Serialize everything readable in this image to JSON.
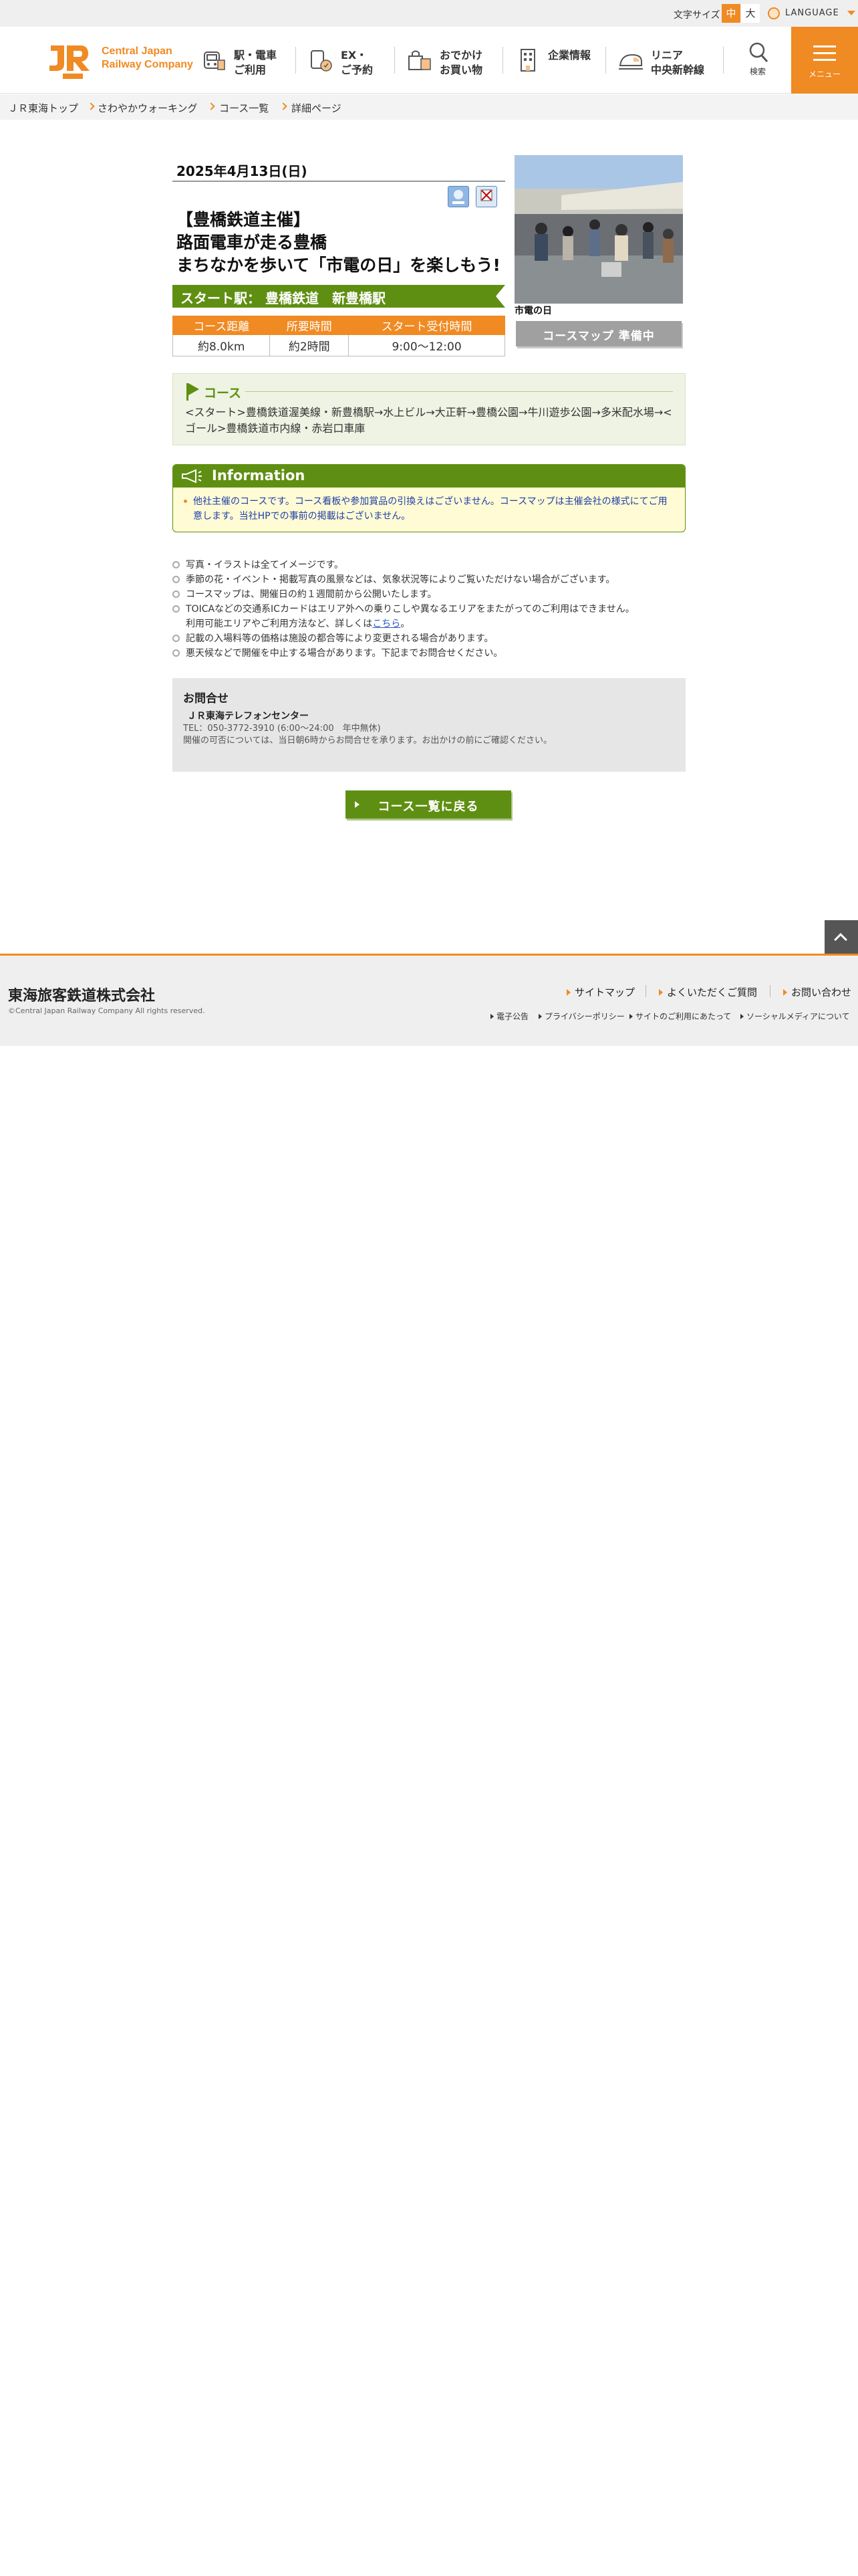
{
  "utility": {
    "font_size_label": "文字サイズ",
    "font_mid": "中",
    "font_large": "大",
    "language": "LANGUAGE"
  },
  "header": {
    "logo_line1": "Central Japan",
    "logo_line2": "Railway Company",
    "nav": [
      {
        "label": "駅・電車\nご利用",
        "icon": "train-icon"
      },
      {
        "label": "EX・\nご予約",
        "icon": "ticket-icon"
      },
      {
        "label": "おでかけ\nお買い物",
        "icon": "shopping-bag-icon"
      },
      {
        "label": "企業情報",
        "icon": "building-icon"
      },
      {
        "label": "リニア\n中央新幹線",
        "icon": "maglev-icon"
      }
    ],
    "search_label": "検索",
    "menu_label": "メニュー"
  },
  "breadcrumb": [
    "ＪＲ東海トップ",
    "さわやかウォーキング",
    "コース一覧",
    "詳細ページ"
  ],
  "event": {
    "date": "2025年4月13日(日)",
    "title": "【豊橋鉄道主催】\n路面電車が走る豊橋\nまちなかを歩いて「市電の日」を楽しもう!",
    "start_station": "スタート駅： 豊橋鉄道　新豊橋駅",
    "table": {
      "headers": [
        "コース距離",
        "所要時間",
        "スタート受付時間"
      ],
      "values": [
        "約8.0km",
        "約2時間",
        "9:00〜12:00"
      ]
    },
    "photo_caption": "市電の日",
    "map_button": "コースマップ 準備中"
  },
  "course": {
    "heading": "コース",
    "route": "<スタート>豊橋鉄道渥美線・新豊橋駅→水上ビル→大正軒→豊橋公園→牛川遊歩公園→多米配水場→<ゴール>豊橋鉄道市内線・赤岩口車庫"
  },
  "information": {
    "heading": "Information",
    "text": "他社主催のコースです。コース看板や参加賞品の引換えはございません。コースマップは主催会社の様式にてご用意します。当社HPでの事前の掲載はございません。"
  },
  "notes": [
    "写真・イラストは全てイメージです。",
    "季節の花・イベント・掲載写真の風景などは、気象状況等によりご覧いただけない場合がございます。",
    "コースマップは、開催日の約１週間前から公開いたします。",
    "TOICAなどの交通系ICカードはエリア外への乗りこしや異なるエリアをまたがってのご利用はできません。",
    "記載の入場料等の価格は施設の都合等により変更される場合があります。",
    "悪天候などで開催を中止する場合があります。下記までお問合せください。"
  ],
  "notes_sub": {
    "text": "利用可能エリアやご利用方法など、詳しくは",
    "link": "こちら",
    "suffix": "。"
  },
  "contact": {
    "heading": "お問合せ",
    "name": "ＪＲ東海テレフォンセンター",
    "tel": "TEL：050-3772-3910 (6:00〜24:00　年中無休)",
    "note": "開催の可否については、当日朝6時からお問合せを承ります。お出かけの前にご確認ください。"
  },
  "back_button": "コース一覧に戻る",
  "footer": {
    "corp": "東海旅客鉄道株式会社",
    "copyright": "©Central Japan Railway Company All rights reserved.",
    "links": [
      "サイトマップ",
      "よくいただくご質問",
      "お問い合わせ"
    ],
    "sublinks": [
      "電子公告",
      "プライバシーポリシー",
      "サイトのご利用にあたって",
      "ソーシャルメディアについて"
    ]
  }
}
